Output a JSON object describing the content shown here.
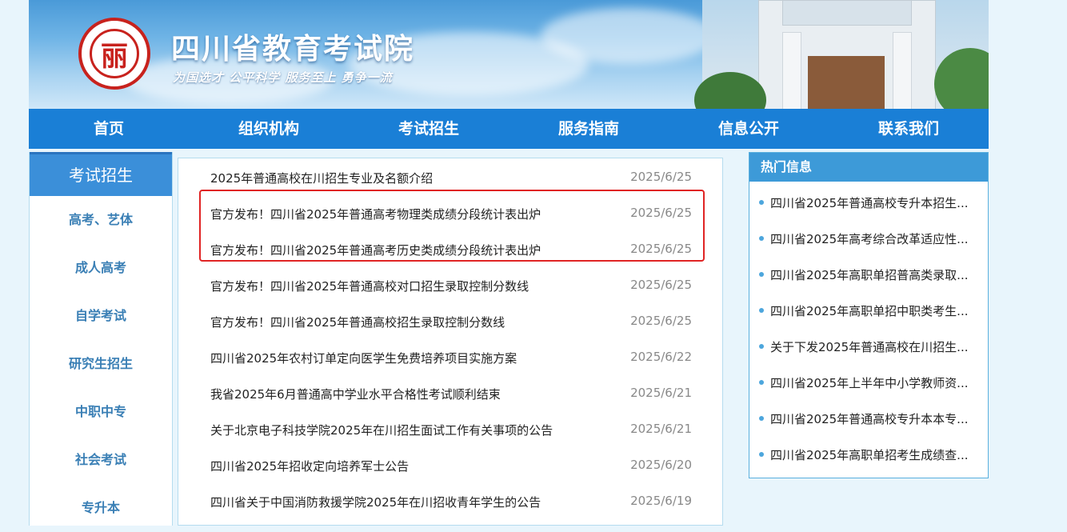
{
  "site": {
    "title": "四川省教育考试院",
    "slogan": "为国选才 公平科学 服务至上 勇争一流",
    "seal_glyph": "丽"
  },
  "nav": [
    "首页",
    "组织机构",
    "考试招生",
    "服务指南",
    "信息公开",
    "联系我们"
  ],
  "sidebar": {
    "heading": "考试招生",
    "items": [
      "高考、艺体",
      "成人高考",
      "自学考试",
      "研究生招生",
      "中职中专",
      "社会考试",
      "专升本"
    ]
  },
  "news": [
    {
      "title": "2025年普通高校在川招生专业及名额介绍",
      "date": "2025/6/25"
    },
    {
      "title": "官方发布！四川省2025年普通高考物理类成绩分段统计表出炉",
      "date": "2025/6/25"
    },
    {
      "title": "官方发布！四川省2025年普通高考历史类成绩分段统计表出炉",
      "date": "2025/6/25"
    },
    {
      "title": "官方发布！四川省2025年普通高校对口招生录取控制分数线",
      "date": "2025/6/25"
    },
    {
      "title": "官方发布！四川省2025年普通高校招生录取控制分数线",
      "date": "2025/6/25"
    },
    {
      "title": "四川省2025年农村订单定向医学生免费培养项目实施方案",
      "date": "2025/6/22"
    },
    {
      "title": "我省2025年6月普通高中学业水平合格性考试顺利结束",
      "date": "2025/6/21"
    },
    {
      "title": "关于北京电子科技学院2025年在川招生面试工作有关事项的公告",
      "date": "2025/6/21"
    },
    {
      "title": "四川省2025年招收定向培养军士公告",
      "date": "2025/6/20"
    },
    {
      "title": "四川省关于中国消防救援学院2025年在川招收青年学生的公告",
      "date": "2025/6/19"
    }
  ],
  "hot": {
    "heading": "热门信息",
    "items": [
      "四川省2025年普通高校专升本招生...",
      "四川省2025年高考综合改革适应性...",
      "四川省2025年高职单招普高类录取...",
      "四川省2025年高职单招中职类考生...",
      "关于下发2025年普通高校在川招生...",
      "四川省2025年上半年中小学教师资...",
      "四川省2025年普通高校专升本本专...",
      "四川省2025年高职单招考生成绩查..."
    ]
  },
  "colors": {
    "nav_bg": "#1a7fd6",
    "sidebar_head_bg": "#3b8fd9",
    "hot_head_bg": "#3d9ad8",
    "highlight_border": "#e02424"
  }
}
